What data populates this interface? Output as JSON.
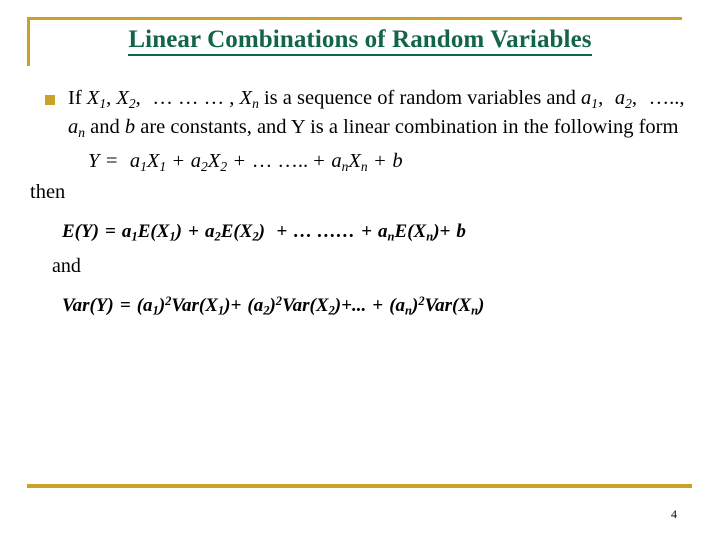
{
  "theme": {
    "accent_gold": "#c9a227",
    "title_green": "#13654a",
    "background": "#ffffff",
    "text_color": "#000000"
  },
  "title": {
    "text": "Linear Combinations of Random Variables"
  },
  "bullet": {
    "marker": "square-bullet-icon",
    "line1_a": "If ",
    "var_X": "X",
    "sub_1": "1",
    "sub_2": "2",
    "sub_n": "n",
    "line1_b": ", ",
    "line1_dots": "… … … ",
    "line1_c": ", ",
    "line1_d": " is a sequence of random variables",
    "line2_a": "and ",
    "var_a": "a",
    "line2_dots": "….., ",
    "line2_b": " and ",
    "var_b": "b",
    "line2_c": " are constants, and Y is a linear",
    "line3": "combination in the following form"
  },
  "equation_y": {
    "lhs": "Y",
    "eq": "=",
    "term1_coef": "a",
    "term1_var": "X",
    "plus": "+",
    "term2_coef": "a",
    "term2_var": "X",
    "dots": "… ….. ",
    "termn_coef": "a",
    "termn_var": "X",
    "constant": "b"
  },
  "then_label": "then",
  "equation_expectation": {
    "lhs": "E(Y)",
    "eq": "=",
    "term1": "a",
    "term1_fn": "E(X",
    "term2": "a",
    "term2_fn": "E(X",
    "dots": "… ……",
    "termn": "a",
    "termn_fn": "E(X",
    "constant": "b",
    "plus": "+",
    "close": ")"
  },
  "and_label": "and",
  "equation_variance": {
    "lhs": "Var(Y)",
    "eq": "=",
    "coef_open": "(",
    "coef": "a",
    "coef_close": ")",
    "power": "2",
    "fn": "Var(X",
    "close": ")",
    "plus": "+",
    "dots": "...",
    "sub_1": "1",
    "sub_2": "2",
    "sub_n": "n"
  },
  "footer": {
    "page_number": "4"
  }
}
